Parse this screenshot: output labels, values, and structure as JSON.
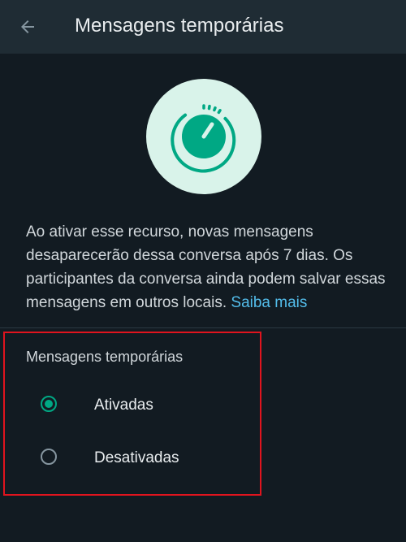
{
  "appbar": {
    "back_icon": "arrow-left-icon",
    "title": "Mensagens temporárias"
  },
  "hero": {
    "icon": "timer-icon",
    "bg_color": "#d9f3ea",
    "icon_color": "#00a884"
  },
  "description": {
    "text": "Ao ativar esse recurso, novas mensagens desaparecerão dessa conversa após 7 dias. Os participantes da conversa ainda podem salvar essas mensagens em outros locais. ",
    "link": "Saiba mais"
  },
  "setting": {
    "title": "Mensagens temporárias",
    "options": [
      {
        "label": "Ativadas",
        "selected": true
      },
      {
        "label": "Desativadas",
        "selected": false
      }
    ]
  },
  "colors": {
    "background": "#121b22",
    "appbar": "#1f2c34",
    "accent": "#00a884",
    "link": "#53bdeb",
    "highlight": "#e0141e"
  }
}
